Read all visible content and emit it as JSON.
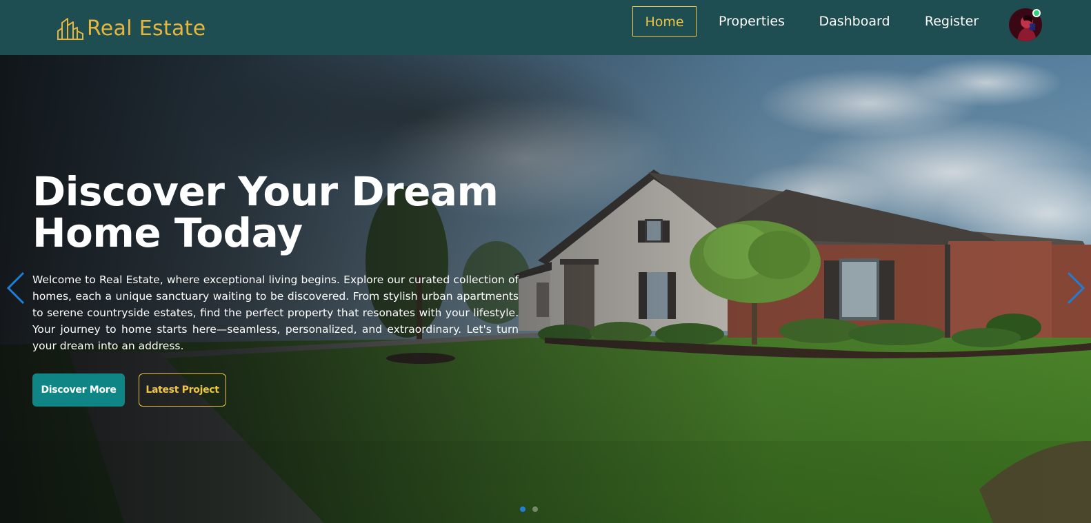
{
  "brand": {
    "name": "Real Estate",
    "icon": "buildings-icon",
    "color": "#e7b73d"
  },
  "nav": {
    "items": [
      {
        "label": "Home",
        "active": true
      },
      {
        "label": "Properties",
        "active": false
      },
      {
        "label": "Dashboard",
        "active": false
      },
      {
        "label": "Register",
        "active": false
      }
    ],
    "avatar": {
      "status": "online"
    }
  },
  "hero": {
    "title_line1": "Discover Your Dream",
    "title_line2": "Home Today",
    "description": "Welcome to Real Estate, where exceptional living begins. Explore our curated collection of homes, each a unique sanctuary waiting to be discovered. From stylish urban apartments to serene countryside estates, find the perfect property that resonates with your lifestyle. Your journey to home starts here—seamless, personalized, and extraordinary. Let's turn your dream into an address.",
    "primary_button": "Discover More",
    "secondary_button": "Latest Project"
  },
  "carousel": {
    "slide_count": 2,
    "active_slide": 1
  },
  "colors": {
    "navbar": "#1e4d52",
    "accent_gold": "#f0c744",
    "accent_teal": "#108585",
    "arrow_blue": "#1e7ed8"
  }
}
